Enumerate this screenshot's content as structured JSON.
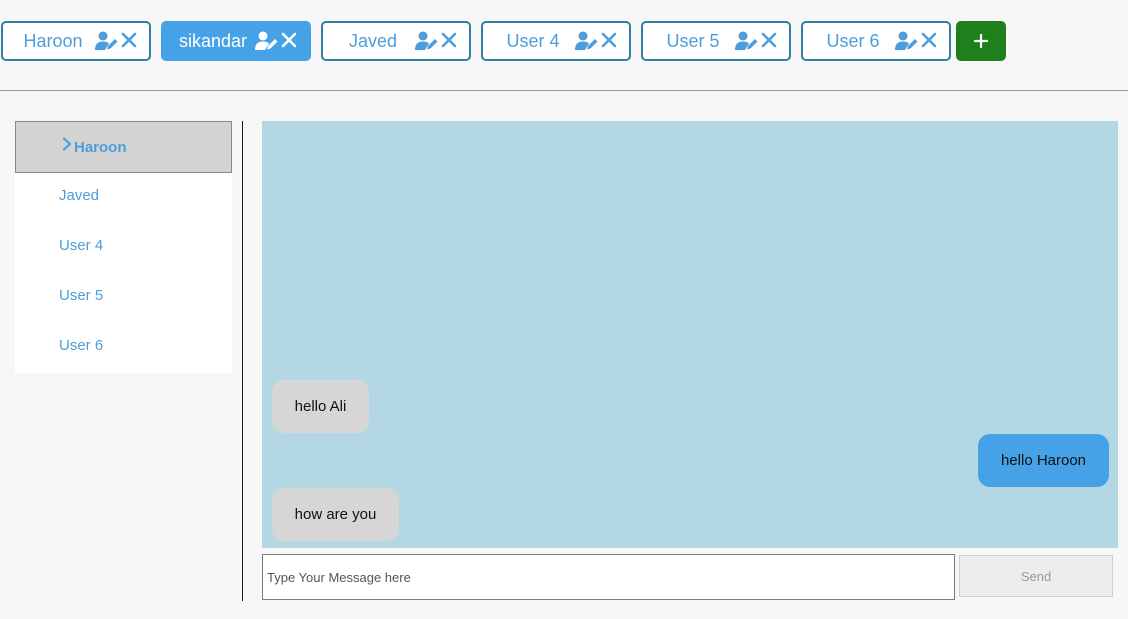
{
  "tabs": [
    {
      "label": "Haroon",
      "active": false
    },
    {
      "label": "sikandar",
      "active": true
    },
    {
      "label": "Javed",
      "active": false
    },
    {
      "label": "User 4",
      "active": false
    },
    {
      "label": "User 5",
      "active": false
    },
    {
      "label": "User 6",
      "active": false
    }
  ],
  "add_button": {
    "label": "+"
  },
  "contacts": [
    {
      "label": "Haroon",
      "selected": true
    },
    {
      "label": "Javed",
      "selected": false
    },
    {
      "label": "User 4",
      "selected": false
    },
    {
      "label": "User 5",
      "selected": false
    },
    {
      "label": "User 6",
      "selected": false
    }
  ],
  "messages": [
    {
      "text": "hello Ali",
      "direction": "received"
    },
    {
      "text": "hello Haroon",
      "direction": "sent"
    },
    {
      "text": "how are you",
      "direction": "received"
    }
  ],
  "composer": {
    "placeholder": "Type Your Message here",
    "value": "",
    "send_label": "Send"
  },
  "colors": {
    "tab_border": "#2f7ea4",
    "tab_active": "#45a2e6",
    "add_button": "#1f7f1d",
    "chat_background": "#b3d8e4",
    "bubble_sent": "#45a2e6",
    "bubble_received": "#d6d6d6",
    "link_text": "#4b9edb"
  },
  "icons": {
    "tab_edit": "user-edit-icon",
    "tab_close": "close-icon",
    "add": "plus-icon",
    "selected_contact": "chevron-right-icon"
  }
}
